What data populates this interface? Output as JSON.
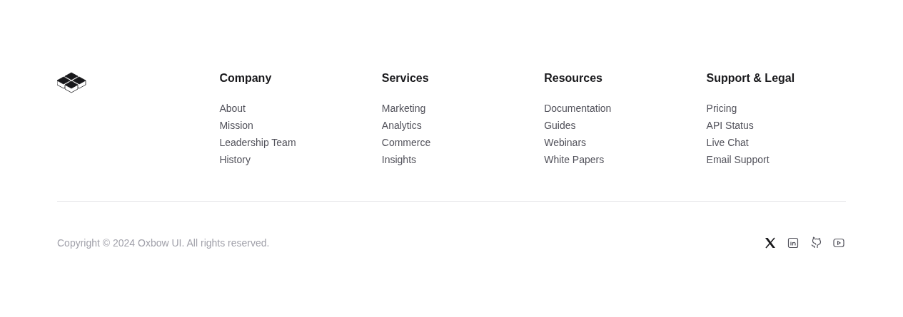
{
  "columns": [
    {
      "heading": "Company",
      "links": [
        "About",
        "Mission",
        "Leadership Team",
        "History"
      ]
    },
    {
      "heading": "Services",
      "links": [
        "Marketing",
        "Analytics",
        "Commerce",
        "Insights"
      ]
    },
    {
      "heading": "Resources",
      "links": [
        "Documentation",
        "Guides",
        "Webinars",
        "White Papers"
      ]
    },
    {
      "heading": "Support & Legal",
      "links": [
        "Pricing",
        "API Status",
        "Live Chat",
        "Email Support"
      ]
    }
  ],
  "copyright": "Copyright © 2024 Oxbow UI. All rights reserved.",
  "social": [
    {
      "kind": "x"
    },
    {
      "kind": "linkedin"
    },
    {
      "kind": "github"
    },
    {
      "kind": "youtube"
    }
  ]
}
